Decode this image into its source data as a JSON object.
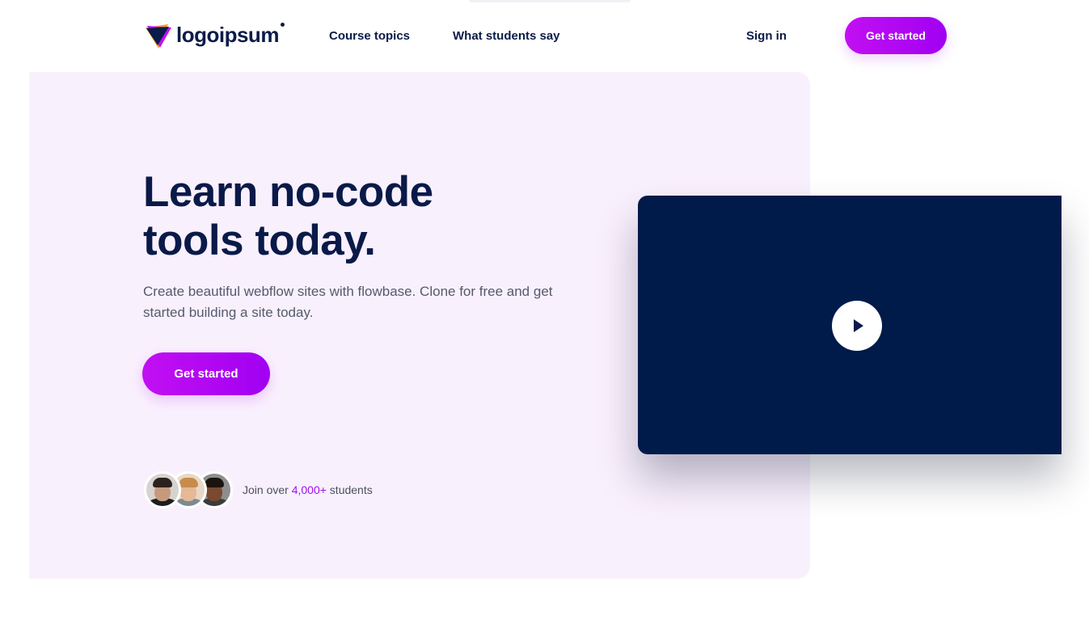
{
  "brand": {
    "name": "logoipsum",
    "logo_icon": "triangle-logo-icon",
    "colors": {
      "navy": "#0b1b4a",
      "purple": "#a100f2",
      "magenta": "#c20ff2",
      "orange": "#ff9e2c"
    }
  },
  "nav": {
    "links": [
      "Course topics",
      "What students say"
    ],
    "sign_in": "Sign in",
    "cta": "Get started"
  },
  "hero": {
    "title_line1": "Learn no-code",
    "title_line2": "tools today.",
    "subtitle": "Create beautiful webflow sites with flowbase. Clone for free and get started building a site today.",
    "cta": "Get started",
    "social_proof": {
      "prefix": "Join over ",
      "count": "4,000+",
      "suffix": " students",
      "avatars": [
        "avatar-1",
        "avatar-2",
        "avatar-3"
      ]
    }
  },
  "video": {
    "play_icon": "play-icon",
    "background": "#001a4a"
  }
}
